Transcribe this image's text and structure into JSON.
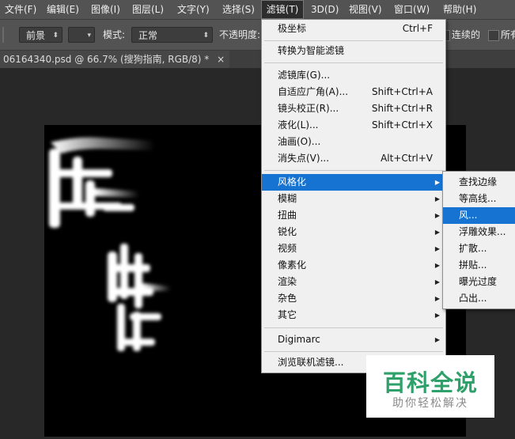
{
  "menubar": {
    "items": [
      "文件(F)",
      "编辑(E)",
      "图像(I)",
      "图层(L)",
      "文字(Y)",
      "选择(S)",
      "滤镜(T)",
      "3D(D)",
      "视图(V)",
      "窗口(W)",
      "帮助(H)"
    ],
    "active": "滤镜(T)"
  },
  "options": {
    "foreground_value": "前景",
    "mode_label": "模式:",
    "mode_value": "正常",
    "opacity_label": "不透明度:",
    "contiguous_label": "连续的",
    "all_layers_label": "所有"
  },
  "document_tab": {
    "title": "06164340.psd @ 66.7% (搜狗指南, RGB/8) *",
    "close_glyph": "×"
  },
  "filter_menu": {
    "items": [
      {
        "label": "极坐标",
        "shortcut": "Ctrl+F"
      },
      {
        "label": "转换为智能滤镜"
      },
      {
        "label": "滤镜库(G)..."
      },
      {
        "label": "自适应广角(A)...",
        "shortcut": "Shift+Ctrl+A"
      },
      {
        "label": "镜头校正(R)...",
        "shortcut": "Shift+Ctrl+R"
      },
      {
        "label": "液化(L)...",
        "shortcut": "Shift+Ctrl+X"
      },
      {
        "label": "油画(O)..."
      },
      {
        "label": "消失点(V)...",
        "shortcut": "Alt+Ctrl+V"
      },
      {
        "label": "风格化",
        "submenu": true,
        "highlighted": true
      },
      {
        "label": "模糊",
        "submenu": true
      },
      {
        "label": "扭曲",
        "submenu": true
      },
      {
        "label": "锐化",
        "submenu": true
      },
      {
        "label": "视频",
        "submenu": true
      },
      {
        "label": "像素化",
        "submenu": true
      },
      {
        "label": "渲染",
        "submenu": true
      },
      {
        "label": "杂色",
        "submenu": true
      },
      {
        "label": "其它",
        "submenu": true
      },
      {
        "label": "Digimarc",
        "submenu": true
      },
      {
        "label": "浏览联机滤镜..."
      }
    ],
    "submenu_glyph": "▶"
  },
  "stylize_submenu": {
    "items": [
      {
        "label": "查找边缘"
      },
      {
        "label": "等高线..."
      },
      {
        "label": "风...",
        "highlighted": true
      },
      {
        "label": "浮雕效果..."
      },
      {
        "label": "扩散..."
      },
      {
        "label": "拼贴..."
      },
      {
        "label": "曝光过度"
      },
      {
        "label": "凸出..."
      }
    ]
  },
  "watermark": {
    "title": "百科全说",
    "subtitle": "助你轻松解决"
  },
  "colors": {
    "highlight": "#1673d1",
    "menubar": "#535353",
    "canvas": "#000000",
    "watermark_green": "#2ea06a"
  }
}
